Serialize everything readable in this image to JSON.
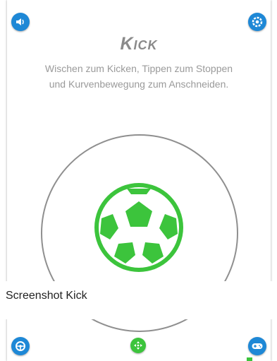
{
  "header": {
    "title": "Kick",
    "instruction_line1": "Wischen zum Kicken, Tippen zum Stoppen",
    "instruction_line2": "und Kurvenbewegung zum Anschneiden.",
    "left_icon": "speaker-icon",
    "right_icon": "settings-icon"
  },
  "control": {
    "ball_icon": "soccer-ball-icon",
    "ball_color": "#3cc43c",
    "ring_color": "#8f8f8f"
  },
  "caption": {
    "text": "Screenshot Kick"
  },
  "footer": {
    "left_icon": "steering-wheel-icon",
    "center_icon": "dpad-icon",
    "right_icon": "gamepad-icon"
  },
  "colors": {
    "accent_blue": "#1e88d6",
    "accent_green": "#3cc43c"
  }
}
